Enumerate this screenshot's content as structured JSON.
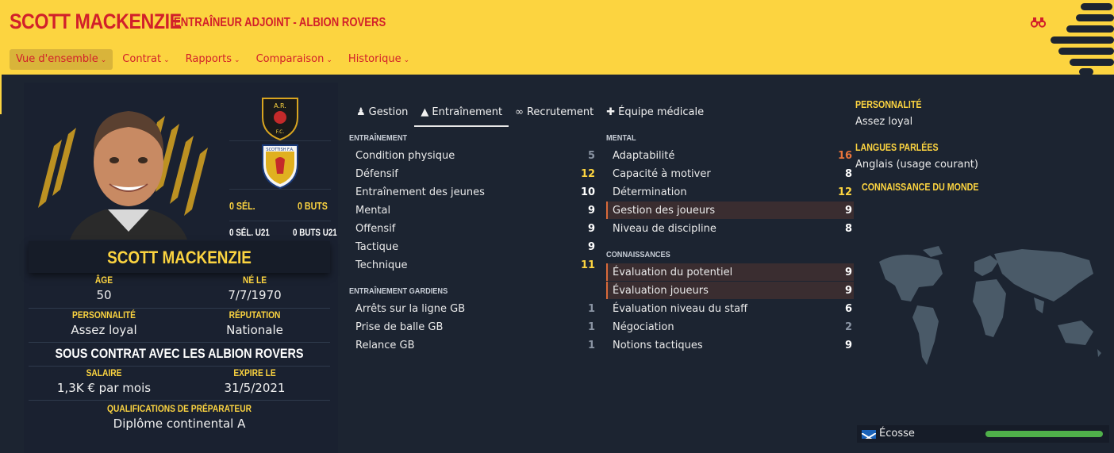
{
  "header": {
    "name": "SCOTT MACKENZIE",
    "subtitle": "ENTRAÎNEUR ADJOINT - ALBION ROVERS",
    "nav": [
      {
        "label": "Vue d'ensemble",
        "active": true
      },
      {
        "label": "Contrat",
        "active": false
      },
      {
        "label": "Rapports",
        "active": false
      },
      {
        "label": "Comparaison",
        "active": false
      },
      {
        "label": "Historique",
        "active": false
      }
    ],
    "chevron": "⌄"
  },
  "colors": {
    "brand_yellow": "#fcd440",
    "brand_red": "#d2202a",
    "background": "#1c2431",
    "value_high": "#fcd440",
    "value_very_high": "#e8743b",
    "value_low": "#8a94a3",
    "value_normal": "#ffffff"
  },
  "clubs": {
    "caps": "0 SÉL.",
    "goals": "0 BUTS",
    "u21_caps": "0 SÉL. U21",
    "u21_goals": "0 BUTS U21",
    "club_badge_text": "A.R.",
    "club_badge_sub": "F.C.",
    "nation_badge_text": "SCOTTISH F.A."
  },
  "profile": {
    "name": "SCOTT MACKENZIE",
    "age_label": "ÂGE",
    "age": "50",
    "born_label": "NÉ LE",
    "born": "7/7/1970",
    "personality_label": "PERSONNALITÉ",
    "personality": "Assez loyal",
    "reputation_label": "RÉPUTATION",
    "reputation": "Nationale",
    "contract": "SOUS CONTRAT AVEC LES ALBION ROVERS",
    "salary_label": "SALAIRE",
    "salary": "1,3K € par mois",
    "expires_label": "EXPIRE LE",
    "expires": "31/5/2021",
    "qualifications_label": "QUALIFICATIONS DE PRÉPARATEUR",
    "qualifications": "Diplôme continental A"
  },
  "tabs": [
    {
      "label": "Gestion",
      "icon": "person-icon",
      "glyph": "♟",
      "active": false
    },
    {
      "label": "Entraînement",
      "icon": "cone-icon",
      "glyph": "▲",
      "active": true
    },
    {
      "label": "Recrutement",
      "icon": "binoculars-icon",
      "glyph": "∞",
      "active": false
    },
    {
      "label": "Équipe médicale",
      "icon": "medical-kit-icon",
      "glyph": "✚",
      "active": false
    }
  ],
  "training": {
    "title": "ENTRAÎNEMENT",
    "rows": [
      {
        "name": "Condition physique",
        "value": "5",
        "level": "low"
      },
      {
        "name": "Défensif",
        "value": "12",
        "level": "high"
      },
      {
        "name": "Entraînement des jeunes",
        "value": "10",
        "level": "normal"
      },
      {
        "name": "Mental",
        "value": "9",
        "level": "normal"
      },
      {
        "name": "Offensif",
        "value": "9",
        "level": "normal"
      },
      {
        "name": "Tactique",
        "value": "9",
        "level": "normal"
      },
      {
        "name": "Technique",
        "value": "11",
        "level": "high"
      }
    ]
  },
  "goalkeeping": {
    "title": "ENTRAÎNEMENT GARDIENS",
    "rows": [
      {
        "name": "Arrêts sur la ligne GB",
        "value": "1",
        "level": "low"
      },
      {
        "name": "Prise de balle GB",
        "value": "1",
        "level": "low"
      },
      {
        "name": "Relance GB",
        "value": "1",
        "level": "low"
      }
    ]
  },
  "mental": {
    "title": "MENTAL",
    "rows": [
      {
        "name": "Adaptabilité",
        "value": "16",
        "level": "very_high",
        "highlight": false
      },
      {
        "name": "Capacité à motiver",
        "value": "8",
        "level": "normal",
        "highlight": false
      },
      {
        "name": "Détermination",
        "value": "12",
        "level": "high",
        "highlight": false
      },
      {
        "name": "Gestion des joueurs",
        "value": "9",
        "level": "normal",
        "highlight": true
      },
      {
        "name": "Niveau de discipline",
        "value": "8",
        "level": "normal",
        "highlight": false
      }
    ]
  },
  "knowledge": {
    "title": "CONNAISSANCES",
    "rows": [
      {
        "name": "Évaluation du potentiel",
        "value": "9",
        "level": "normal",
        "highlight": true
      },
      {
        "name": "Évaluation joueurs",
        "value": "9",
        "level": "normal",
        "highlight": true
      },
      {
        "name": "Évaluation niveau du staff",
        "value": "6",
        "level": "normal",
        "highlight": false
      },
      {
        "name": "Négociation",
        "value": "2",
        "level": "low",
        "highlight": false
      },
      {
        "name": "Notions tactiques",
        "value": "9",
        "level": "normal",
        "highlight": false
      }
    ]
  },
  "right": {
    "personality_label": "PERSONNALITÉ",
    "personality": "Assez loyal",
    "languages_label": "LANGUES PARLÉES",
    "languages": "Anglais (usage courant)",
    "world_label": "CONNAISSANCE DU MONDE",
    "nation": "Écosse",
    "nation_knowledge": 1.0
  }
}
